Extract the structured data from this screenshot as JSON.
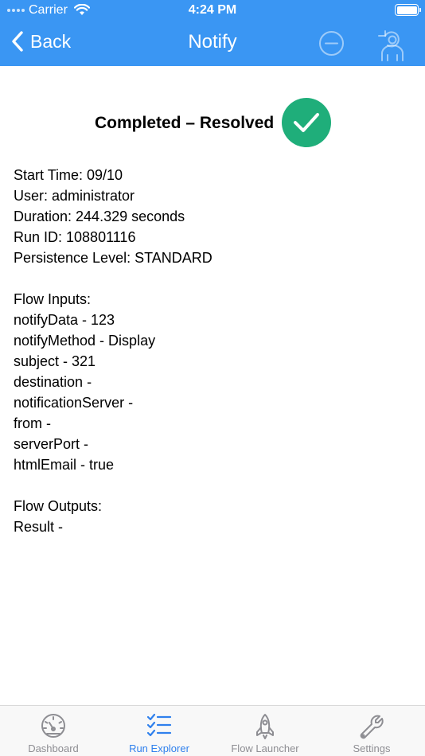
{
  "status_bar": {
    "carrier": "Carrier",
    "time": "4:24 PM"
  },
  "nav": {
    "back_label": "Back",
    "title": "Notify"
  },
  "status": {
    "title": "Completed – Resolved",
    "color": "#1fae7a"
  },
  "details": {
    "start_time": "Start Time: 09/10",
    "user": "User: administrator",
    "duration": "Duration: 244.329 seconds",
    "run_id": "Run ID: 108801116",
    "persistence": "Persistence Level: STANDARD",
    "inputs_header": "Flow Inputs:",
    "inputs": [
      "notifyData - 123",
      "notifyMethod - Display",
      "subject - 321",
      "destination -",
      "notificationServer -",
      "from -",
      "serverPort -",
      "htmlEmail - true"
    ],
    "outputs_header": "Flow Outputs:",
    "outputs": [
      "Result -"
    ]
  },
  "tabs": [
    {
      "label": "Dashboard",
      "icon": "dashboard-gauge-icon",
      "active": false
    },
    {
      "label": "Run Explorer",
      "icon": "checklist-icon",
      "active": true
    },
    {
      "label": "Flow Launcher",
      "icon": "rocket-icon",
      "active": false
    },
    {
      "label": "Settings",
      "icon": "wrench-icon",
      "active": false
    }
  ],
  "colors": {
    "header": "#3a96f3",
    "active_tab": "#2f80ed",
    "inactive_tab": "#8e8e93"
  }
}
